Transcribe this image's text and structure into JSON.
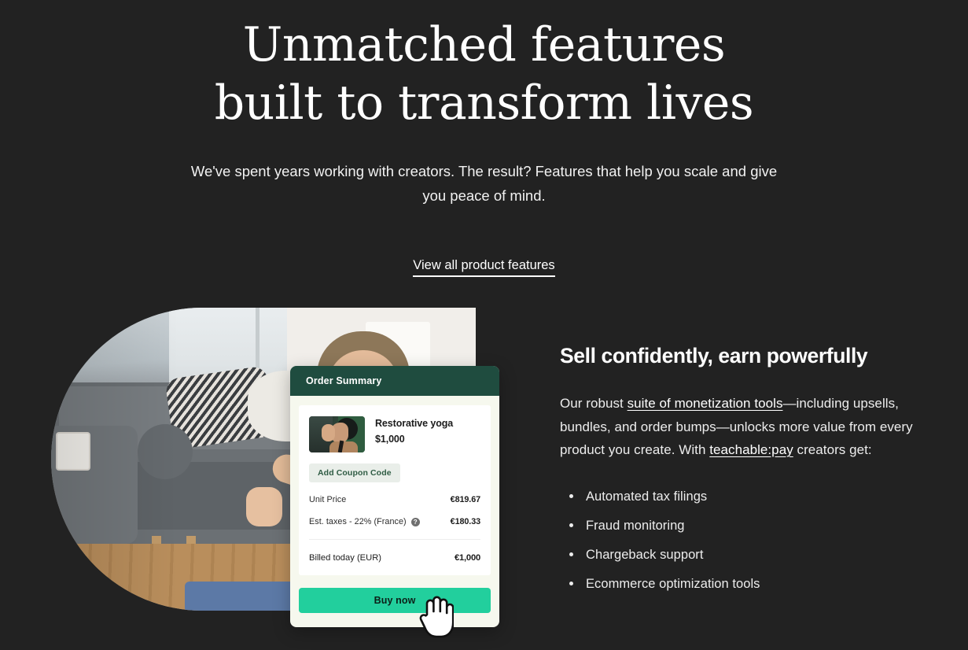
{
  "hero": {
    "title": "Unmatched features built to transform lives",
    "subtitle": "We've spent years working with creators. The result? Features that help you scale and give you peace of mind.",
    "link_label": "View all product features"
  },
  "feature": {
    "heading": "Sell confidently, earn powerfully",
    "paragraph": {
      "part1": "Our robust ",
      "link1": "suite of monetization tools",
      "part2": "—including upsells, bundles, and order bumps—unlocks more value from every product you create. With ",
      "link2": "teachable:pay",
      "part3": " creators get:"
    },
    "bullets": [
      "Automated tax filings",
      "Fraud monitoring",
      "Chargeback support",
      "Ecommerce optimization tools"
    ]
  },
  "order_summary": {
    "header_title": "Order Summary",
    "product": {
      "name": "Restorative yoga",
      "price": "$1,000",
      "thumbnail_icon": "product-photo"
    },
    "coupon_label": "Add Coupon Code",
    "rows": [
      {
        "label": "Unit Price",
        "value": "€819.67",
        "has_help": false
      },
      {
        "label": "Est. taxes - 22% (France)",
        "value": "€180.33",
        "has_help": true
      }
    ],
    "help_icon_glyph": "?",
    "total": {
      "label": "Billed today (EUR)",
      "value": "€1,000"
    },
    "buy_label": "Buy now"
  },
  "cursor": {
    "icon": "pointing-hand-cursor"
  },
  "colors": {
    "page_background": "#222222",
    "card_header_green": "#1f4c3f",
    "card_body": "#f6f8ee",
    "buy_button_green": "#22cf9d",
    "coupon_chip": "#e9eee9",
    "coupon_text": "#2f5c44"
  }
}
